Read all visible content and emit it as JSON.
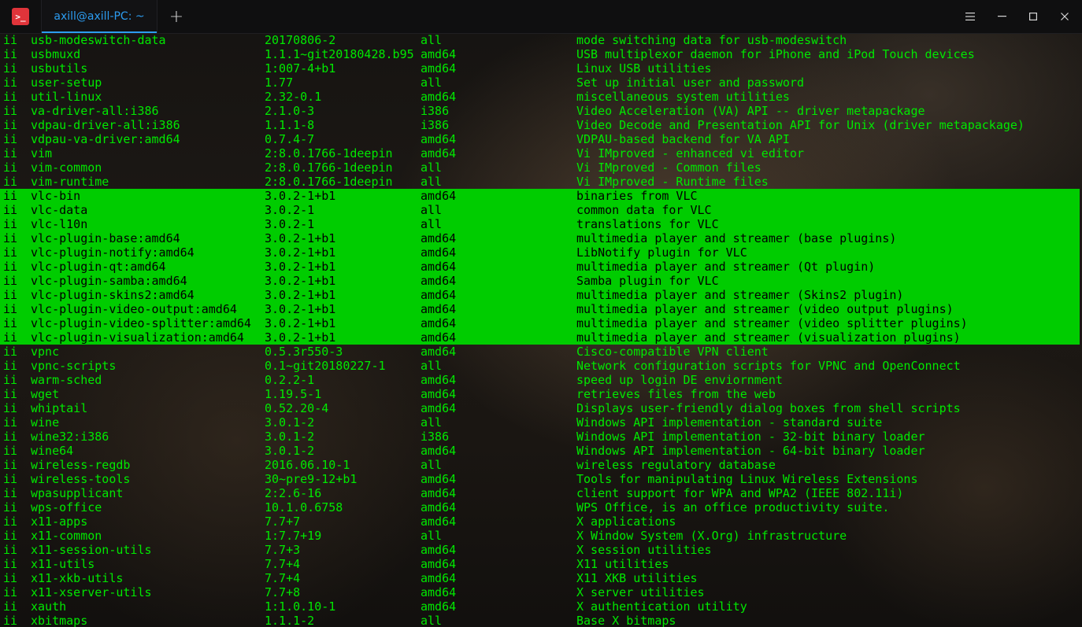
{
  "window": {
    "tab_title": "axill@axill-PC: ~",
    "new_tab_label": "+",
    "app_icon_glyph": ">_",
    "icons": {
      "app": "terminal-icon",
      "menu": "hamburger-menu-icon",
      "minimize": "minimize-icon",
      "maximize": "maximize-icon",
      "close": "close-icon"
    },
    "colors": {
      "accent": "#2c9cf0",
      "text": "#00e800",
      "selection": "#00cc00",
      "app_icon": "#e0343a"
    }
  },
  "terminal": {
    "selected_range": [
      11,
      21
    ],
    "rows": [
      {
        "status": "ii",
        "name": "usb-modeswitch-data",
        "version": "20170806-2",
        "arch": "all",
        "desc": "mode switching data for usb-modeswitch"
      },
      {
        "status": "ii",
        "name": "usbmuxd",
        "version": "1.1.1~git20180428.b95",
        "arch": "amd64",
        "desc": "USB multiplexor daemon for iPhone and iPod Touch devices"
      },
      {
        "status": "ii",
        "name": "usbutils",
        "version": "1:007-4+b1",
        "arch": "amd64",
        "desc": "Linux USB utilities"
      },
      {
        "status": "ii",
        "name": "user-setup",
        "version": "1.77",
        "arch": "all",
        "desc": "Set up initial user and password"
      },
      {
        "status": "ii",
        "name": "util-linux",
        "version": "2.32-0.1",
        "arch": "amd64",
        "desc": "miscellaneous system utilities"
      },
      {
        "status": "ii",
        "name": "va-driver-all:i386",
        "version": "2.1.0-3",
        "arch": "i386",
        "desc": "Video Acceleration (VA) API -- driver metapackage"
      },
      {
        "status": "ii",
        "name": "vdpau-driver-all:i386",
        "version": "1.1.1-8",
        "arch": "i386",
        "desc": "Video Decode and Presentation API for Unix (driver metapackage)"
      },
      {
        "status": "ii",
        "name": "vdpau-va-driver:amd64",
        "version": "0.7.4-7",
        "arch": "amd64",
        "desc": "VDPAU-based backend for VA API"
      },
      {
        "status": "ii",
        "name": "vim",
        "version": "2:8.0.1766-1deepin",
        "arch": "amd64",
        "desc": "Vi IMproved - enhanced vi editor"
      },
      {
        "status": "ii",
        "name": "vim-common",
        "version": "2:8.0.1766-1deepin",
        "arch": "all",
        "desc": "Vi IMproved - Common files"
      },
      {
        "status": "ii",
        "name": "vim-runtime",
        "version": "2:8.0.1766-1deepin",
        "arch": "all",
        "desc": "Vi IMproved - Runtime files"
      },
      {
        "status": "ii",
        "name": "vlc-bin",
        "version": "3.0.2-1+b1",
        "arch": "amd64",
        "desc": "binaries from VLC"
      },
      {
        "status": "ii",
        "name": "vlc-data",
        "version": "3.0.2-1",
        "arch": "all",
        "desc": "common data for VLC"
      },
      {
        "status": "ii",
        "name": "vlc-l10n",
        "version": "3.0.2-1",
        "arch": "all",
        "desc": "translations for VLC"
      },
      {
        "status": "ii",
        "name": "vlc-plugin-base:amd64",
        "version": "3.0.2-1+b1",
        "arch": "amd64",
        "desc": "multimedia player and streamer (base plugins)"
      },
      {
        "status": "ii",
        "name": "vlc-plugin-notify:amd64",
        "version": "3.0.2-1+b1",
        "arch": "amd64",
        "desc": "LibNotify plugin for VLC"
      },
      {
        "status": "ii",
        "name": "vlc-plugin-qt:amd64",
        "version": "3.0.2-1+b1",
        "arch": "amd64",
        "desc": "multimedia player and streamer (Qt plugin)"
      },
      {
        "status": "ii",
        "name": "vlc-plugin-samba:amd64",
        "version": "3.0.2-1+b1",
        "arch": "amd64",
        "desc": "Samba plugin for VLC"
      },
      {
        "status": "ii",
        "name": "vlc-plugin-skins2:amd64",
        "version": "3.0.2-1+b1",
        "arch": "amd64",
        "desc": "multimedia player and streamer (Skins2 plugin)"
      },
      {
        "status": "ii",
        "name": "vlc-plugin-video-output:amd64",
        "version": "3.0.2-1+b1",
        "arch": "amd64",
        "desc": "multimedia player and streamer (video output plugins)"
      },
      {
        "status": "ii",
        "name": "vlc-plugin-video-splitter:amd64",
        "version": "3.0.2-1+b1",
        "arch": "amd64",
        "desc": "multimedia player and streamer (video splitter plugins)"
      },
      {
        "status": "ii",
        "name": "vlc-plugin-visualization:amd64",
        "version": "3.0.2-1+b1",
        "arch": "amd64",
        "desc": "multimedia player and streamer (visualization plugins)"
      },
      {
        "status": "ii",
        "name": "vpnc",
        "version": "0.5.3r550-3",
        "arch": "amd64",
        "desc": "Cisco-compatible VPN client"
      },
      {
        "status": "ii",
        "name": "vpnc-scripts",
        "version": "0.1~git20180227-1",
        "arch": "all",
        "desc": "Network configuration scripts for VPNC and OpenConnect"
      },
      {
        "status": "ii",
        "name": "warm-sched",
        "version": "0.2.2-1",
        "arch": "amd64",
        "desc": "speed up login DE enviornment"
      },
      {
        "status": "ii",
        "name": "wget",
        "version": "1.19.5-1",
        "arch": "amd64",
        "desc": "retrieves files from the web"
      },
      {
        "status": "ii",
        "name": "whiptail",
        "version": "0.52.20-4",
        "arch": "amd64",
        "desc": "Displays user-friendly dialog boxes from shell scripts"
      },
      {
        "status": "ii",
        "name": "wine",
        "version": "3.0.1-2",
        "arch": "all",
        "desc": "Windows API implementation - standard suite"
      },
      {
        "status": "ii",
        "name": "wine32:i386",
        "version": "3.0.1-2",
        "arch": "i386",
        "desc": "Windows API implementation - 32-bit binary loader"
      },
      {
        "status": "ii",
        "name": "wine64",
        "version": "3.0.1-2",
        "arch": "amd64",
        "desc": "Windows API implementation - 64-bit binary loader"
      },
      {
        "status": "ii",
        "name": "wireless-regdb",
        "version": "2016.06.10-1",
        "arch": "all",
        "desc": "wireless regulatory database"
      },
      {
        "status": "ii",
        "name": "wireless-tools",
        "version": "30~pre9-12+b1",
        "arch": "amd64",
        "desc": "Tools for manipulating Linux Wireless Extensions"
      },
      {
        "status": "ii",
        "name": "wpasupplicant",
        "version": "2:2.6-16",
        "arch": "amd64",
        "desc": "client support for WPA and WPA2 (IEEE 802.11i)"
      },
      {
        "status": "ii",
        "name": "wps-office",
        "version": "10.1.0.6758",
        "arch": "amd64",
        "desc": "WPS Office, is an office productivity suite."
      },
      {
        "status": "ii",
        "name": "x11-apps",
        "version": "7.7+7",
        "arch": "amd64",
        "desc": "X applications"
      },
      {
        "status": "ii",
        "name": "x11-common",
        "version": "1:7.7+19",
        "arch": "all",
        "desc": "X Window System (X.Org) infrastructure"
      },
      {
        "status": "ii",
        "name": "x11-session-utils",
        "version": "7.7+3",
        "arch": "amd64",
        "desc": "X session utilities"
      },
      {
        "status": "ii",
        "name": "x11-utils",
        "version": "7.7+4",
        "arch": "amd64",
        "desc": "X11 utilities"
      },
      {
        "status": "ii",
        "name": "x11-xkb-utils",
        "version": "7.7+4",
        "arch": "amd64",
        "desc": "X11 XKB utilities"
      },
      {
        "status": "ii",
        "name": "x11-xserver-utils",
        "version": "7.7+8",
        "arch": "amd64",
        "desc": "X server utilities"
      },
      {
        "status": "ii",
        "name": "xauth",
        "version": "1:1.0.10-1",
        "arch": "amd64",
        "desc": "X authentication utility"
      },
      {
        "status": "ii",
        "name": "xbitmaps",
        "version": "1.1.1-2",
        "arch": "all",
        "desc": "Base X bitmaps"
      }
    ]
  }
}
